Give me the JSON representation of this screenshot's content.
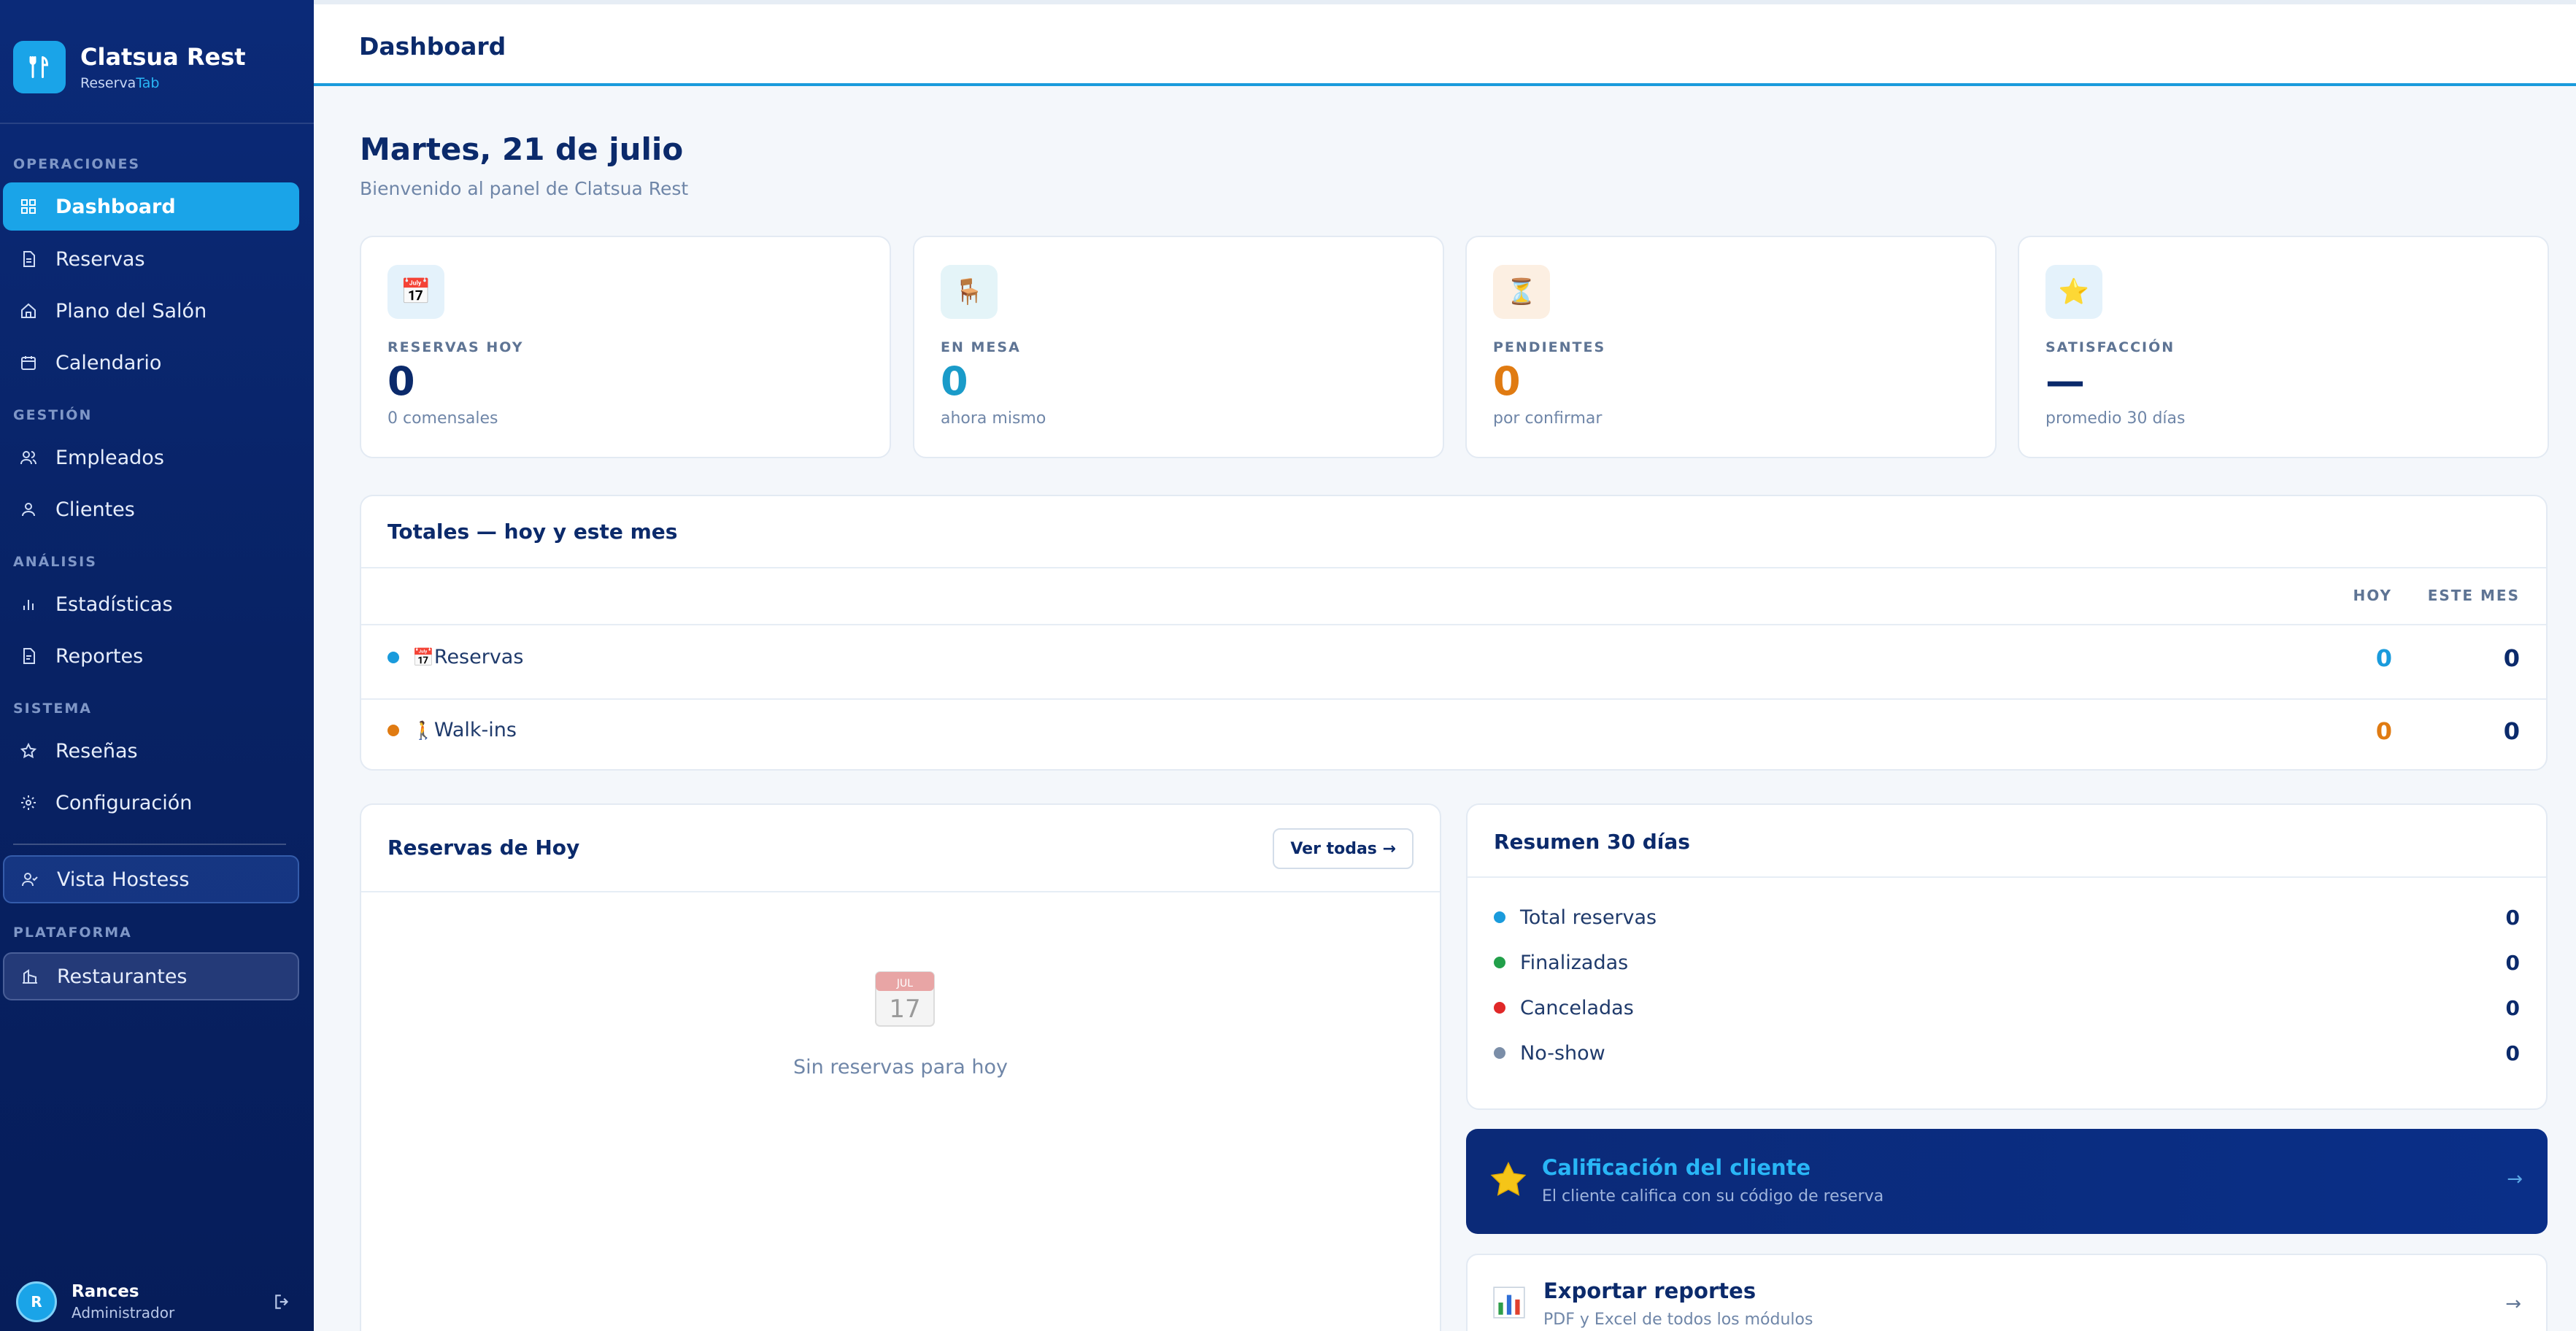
{
  "sidebar": {
    "brand_name": "Clatsua Rest",
    "brand_sub_prefix": "Reserva",
    "brand_sub_accent": "Tab",
    "sections": {
      "operaciones": "OPERACIONES",
      "gestion": "GESTIÓN",
      "analisis": "ANÁLISIS",
      "sistema": "SISTEMA",
      "plataforma": "PLATAFORMA"
    },
    "items": {
      "dashboard": "Dashboard",
      "reservas": "Reservas",
      "plano": "Plano del Salón",
      "calendario": "Calendario",
      "empleados": "Empleados",
      "clientes": "Clientes",
      "estadisticas": "Estadísticas",
      "reportes": "Reportes",
      "resenas": "Reseñas",
      "configuracion": "Configuración",
      "vista_hostess": "Vista Hostess",
      "restaurantes": "Restaurantes"
    },
    "user": {
      "initial": "R",
      "name": "Rances",
      "role": "Administrador"
    }
  },
  "topbar": {
    "title": "Dashboard"
  },
  "header": {
    "date": "Martes, 21 de julio",
    "subtitle": "Bienvenido al panel de Clatsua Rest"
  },
  "stats": [
    {
      "icon": "calendar-icon",
      "label": "RESERVAS HOY",
      "value": "0",
      "note": "0 comensales",
      "color": "#0b2a6b"
    },
    {
      "icon": "chair-icon",
      "label": "EN MESA",
      "value": "0",
      "note": "ahora mismo",
      "color": "#1a9bc9"
    },
    {
      "icon": "hourglass-icon",
      "label": "PENDIENTES",
      "value": "0",
      "note": "por confirmar",
      "color": "#e07b12"
    },
    {
      "icon": "star-icon",
      "label": "SATISFACCIÓN",
      "value": "—",
      "note": "promedio 30 días",
      "color": "#0b2a6b"
    }
  ],
  "totals": {
    "title": "Totales — hoy y este mes",
    "col_hoy": "HOY",
    "col_mes": "ESTE MES",
    "rows": [
      {
        "label": "Reservas",
        "hoy": "0",
        "mes": "0",
        "dot_color": "#1a9bdc",
        "hoy_color": "#1a9bdc"
      },
      {
        "label": "Walk-ins",
        "hoy": "0",
        "mes": "0",
        "dot_color": "#e07b12",
        "hoy_color": "#e07b12"
      }
    ]
  },
  "today": {
    "title": "Reservas de Hoy",
    "button": "Ver todas →",
    "empty_icon_month": "JUL",
    "empty_icon_day": "17",
    "empty_text": "Sin reservas para hoy"
  },
  "summary": {
    "title": "Resumen 30 días",
    "rows": [
      {
        "label": "Total reservas",
        "value": "0",
        "color": "#1a9bdc"
      },
      {
        "label": "Finalizadas",
        "value": "0",
        "color": "#22a04a"
      },
      {
        "label": "Canceladas",
        "value": "0",
        "color": "#e02828"
      },
      {
        "label": "No-show",
        "value": "0",
        "color": "#7b8ea8"
      }
    ]
  },
  "cta": {
    "title": "Calificación del cliente",
    "subtitle": "El cliente califica con su código de reserva",
    "arrow": "→"
  },
  "export": {
    "title": "Exportar reportes",
    "subtitle": "PDF y Excel de todos los módulos",
    "arrow": "→"
  }
}
